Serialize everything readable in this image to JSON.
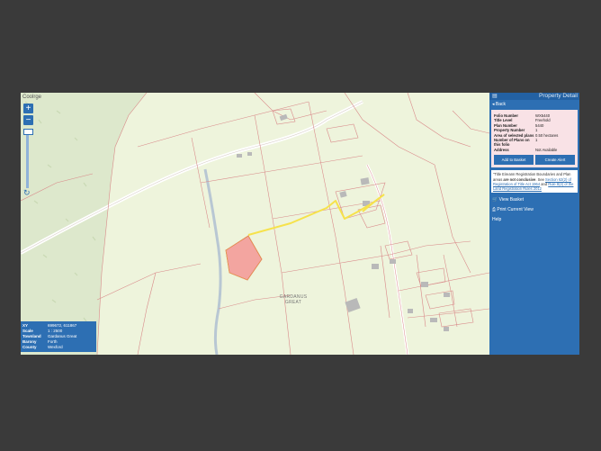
{
  "map": {
    "corner_label": "Coolrge",
    "zoom_in": "+",
    "zoom_out": "−",
    "refresh_icon": "↻",
    "place_label_line1": "GARDANUS",
    "place_label_line2": "GREAT",
    "colors": {
      "background": "#eef4dc",
      "forest": "#dde8cc",
      "boundary": "#d98a8a",
      "selected_parcel": "#f3a5a0",
      "highlight_road": "#f6e24b",
      "water": "#b8c7d3"
    }
  },
  "info": {
    "rows": [
      {
        "label": "XY",
        "value": "699672, 611867"
      },
      {
        "label": "Scale",
        "value": "1 : 2500"
      },
      {
        "label": "Townland",
        "value": "Gardanus Great"
      },
      {
        "label": "Barony",
        "value": "Forth"
      },
      {
        "label": "County",
        "value": "Wexford"
      }
    ]
  },
  "panel": {
    "menu_icon": "▤",
    "title": "Property Detail",
    "back": "◂  Back",
    "details": [
      {
        "label": "Folio Number",
        "value": "WX5440"
      },
      {
        "label": "Title Level",
        "value": "Freehold"
      },
      {
        "label": "Plan Number",
        "value": "5440"
      },
      {
        "label": "Property Number",
        "value": "1"
      },
      {
        "label": "Area of selected plans",
        "value": "0.50 hectares"
      },
      {
        "label": "Number of Plans on this folio",
        "value": "1"
      },
      {
        "label": "Address",
        "value": "Not Available"
      }
    ],
    "add_basket": "Add to Basket",
    "create_alert": "Create Alert",
    "note_start": "\"Title Eireann Registration Boundaries and Plan areas",
    "note_bold": " are not conclusive",
    "note_mid": ". See ",
    "note_link1": "Section 62(2) of Registration of Title Act 1964",
    "note_and": " and ",
    "note_link2": "Rule 8(3) of the Land Registration Rules 2012",
    "view_basket": "View Basket",
    "print_view": "Print Current View",
    "help": "Help"
  }
}
